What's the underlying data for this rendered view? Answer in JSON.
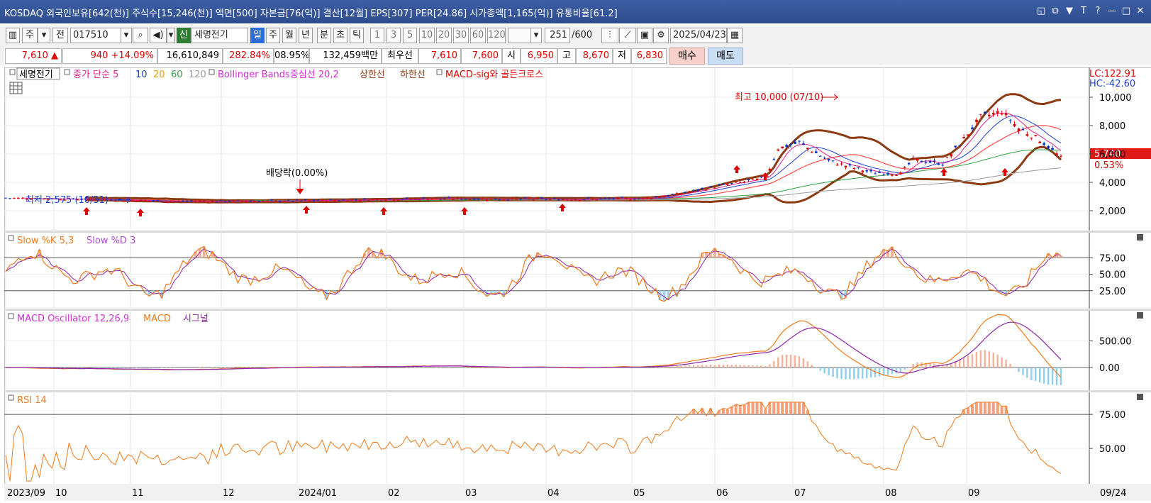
{
  "window": {
    "title": "KOSDAQ 외국인보유[642(천)] 주식수[15,246(천)] 액면[500] 자본금[76(억)] 결산[12월] EPS[307] PER[24.86] 시가총액[1,165(억)] 유통비율[61.2]",
    "buttons": [
      "◱",
      "⧉",
      "▼",
      "T",
      "?",
      "—",
      "□",
      "✕"
    ]
  },
  "toolbar": {
    "code_type": "주",
    "prev_label": "전",
    "stock_code": "017510",
    "new_badge": "신",
    "stock_name": "세명전기",
    "periods": [
      "일",
      "주",
      "월",
      "년",
      "분",
      "초",
      "틱"
    ],
    "active_period": "일",
    "intervals": [
      "1",
      "3",
      "5",
      "10",
      "20",
      "30",
      "60",
      "120"
    ],
    "count": "251",
    "count_total": "/600",
    "date": "2025/04/23"
  },
  "quote": {
    "price": "7,610",
    "change_icon": "▲",
    "change": "940",
    "change_pct": "+14.09%",
    "volume": "16,610,849",
    "volume_ratio": "282.84%",
    "turnover": "08.95%",
    "amount": "132,459백만",
    "priority_label": "최우선",
    "ask": "7,610",
    "bid": "7,600",
    "open_label": "시",
    "open": "6,950",
    "high_label": "고",
    "high": "8,670",
    "low_label": "저",
    "low": "6,830",
    "buy_label": "매수",
    "sell_label": "매도"
  },
  "colors": {
    "up": "#e00000",
    "down": "#0033cc",
    "bb": "#8b3a12",
    "ma5": "#e0218a",
    "ma10": "#1f3fd0",
    "ma20": "#ff4d4d",
    "ma60": "#2ea043",
    "ma120": "#9a9a9a"
  },
  "price_panel": {
    "legend_name": "세명전기",
    "legend_ma": "종가 단순 5",
    "ma_periods": [
      "10",
      "20",
      "60",
      "120"
    ],
    "legend_bb": "Bollinger Bands중심선 20,2",
    "legend_upper": "상한선",
    "legend_lower": "하한선",
    "legend_macd_signal": "MACD-sig와 골든크로스",
    "lc": "LC:122.91",
    "hc": "HC:-42.60",
    "yticks": [
      "10,000",
      "8,000",
      "6,000",
      "4,000",
      "2,000"
    ],
    "last_price": "5,740",
    "last_pct": "0.53%",
    "max_annotation": "최고 10,000 (07/10)",
    "min_annotation": "최저 2,575 (10/31)",
    "dividend_annotation": "배당락(0.00%)"
  },
  "stoch_panel": {
    "legend_k": "Slow %K 5,3",
    "legend_d": "Slow %D 3",
    "yticks": [
      "75.00",
      "50.00",
      "25.00"
    ]
  },
  "macd_panel": {
    "legend_osc": "MACD Oscillator 12,26,9",
    "legend_macd": "MACD",
    "legend_signal": "시그널",
    "yticks": [
      "500.00",
      "0.00"
    ]
  },
  "rsi_panel": {
    "legend": "RSI 14",
    "yticks": [
      "75.00",
      "50.00"
    ]
  },
  "x_axis": {
    "labels": [
      "2023/09",
      "10",
      "11",
      "12",
      "2024/01",
      "02",
      "03",
      "04",
      "05",
      "06",
      "07",
      "08",
      "09"
    ],
    "end_label": "09/24"
  }
}
